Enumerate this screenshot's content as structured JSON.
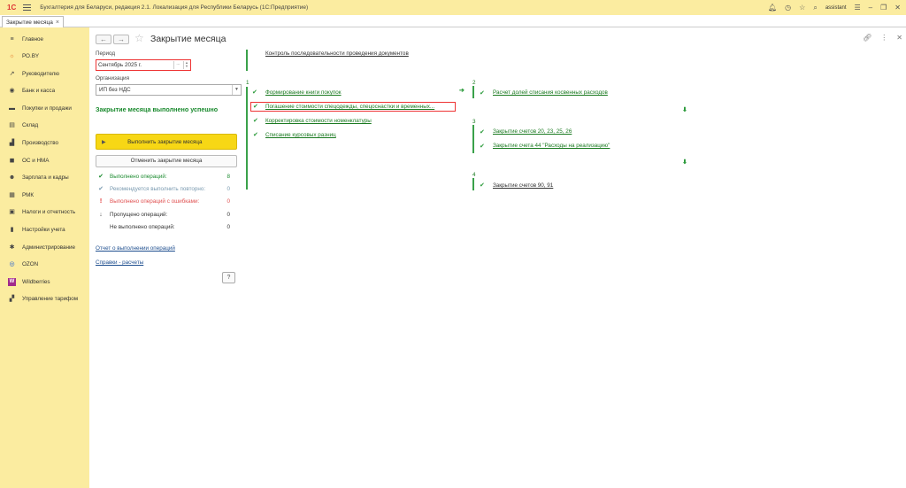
{
  "titlebar": {
    "logo": "1С",
    "title": "Бухгалтерия для Беларуси, редакция 2.1. Локализация для Республики Беларусь  (1С:Предприятие)",
    "user": "assistant"
  },
  "tab": {
    "label": "Закрытие месяца",
    "close": "×"
  },
  "sidebar": {
    "items": [
      {
        "label": "Главное",
        "icon": "≡"
      },
      {
        "label": "РО.BY",
        "icon": "☼"
      },
      {
        "label": "Руководителю",
        "icon": "↗"
      },
      {
        "label": "Банк и касса",
        "icon": "◉"
      },
      {
        "label": "Покупки и продажи",
        "icon": "▬"
      },
      {
        "label": "Склад",
        "icon": "▤"
      },
      {
        "label": "Производство",
        "icon": "▟"
      },
      {
        "label": "ОС и НМА",
        "icon": "◼"
      },
      {
        "label": "Зарплата и кадры",
        "icon": "☻"
      },
      {
        "label": "РМК",
        "icon": "▦"
      },
      {
        "label": "Налоги и отчетность",
        "icon": "▣"
      },
      {
        "label": "Настройки учета",
        "icon": "▮"
      },
      {
        "label": "Администрирование",
        "icon": "✱"
      },
      {
        "label": "OZON",
        "icon": "◎"
      },
      {
        "label": "Wildberries",
        "icon": "W"
      },
      {
        "label": "Управление тарифом",
        "icon": "▞"
      }
    ]
  },
  "form": {
    "back": "←",
    "forward": "→",
    "star": "☆",
    "title": "Закрытие месяца",
    "period_label": "Период",
    "period_value": "Сентябрь 2025 г.",
    "period_dots": "...",
    "org_label": "Организация",
    "org_value": "ИП без НДС",
    "success": "Закрытие месяца выполнено успешно",
    "run_button": "Выполнить закрытие месяца",
    "cancel_button": "Отменить закрытие месяца",
    "help": "?",
    "report_link": "Отчет о выполнении операций",
    "help_link": "Справки - расчеты"
  },
  "stats": [
    {
      "label": "Выполнено операций:",
      "value": "8",
      "color": "#1a8a2e",
      "icon": "✔"
    },
    {
      "label": "Рекомендуется выполнить повторно:",
      "value": "0",
      "color": "#7a9ab0",
      "icon": "✔"
    },
    {
      "label": "Выполнено операций с ошибками:",
      "value": "0",
      "color": "#e05050",
      "icon": "!"
    },
    {
      "label": "Пропущено операций:",
      "value": "0",
      "color": "#333333",
      "icon": "↓"
    },
    {
      "label": "Не выполнено операций:",
      "value": "0",
      "color": "#333333",
      "icon": ""
    }
  ],
  "ops": {
    "control_link": "Контроль последовательности проведения документов",
    "col1_num": "1",
    "col1": [
      "Формирование книги покупок",
      "Погашение стоимости спецодежды, спецоснастки и временных...",
      "Корректировка стоимости номенклатуры",
      "Списание курсовых разниц"
    ],
    "col2_num": "2",
    "col2": [
      "Расчет долей списания косвенных расходов"
    ],
    "col3_num": "3",
    "col3": [
      "Закрытие счетов 20, 23, 25, 26",
      "Закрытие счета 44 \"Расходы на реализацию\""
    ],
    "col4_num": "4",
    "col4": [
      "Закрытие счетов 90, 91"
    ]
  }
}
